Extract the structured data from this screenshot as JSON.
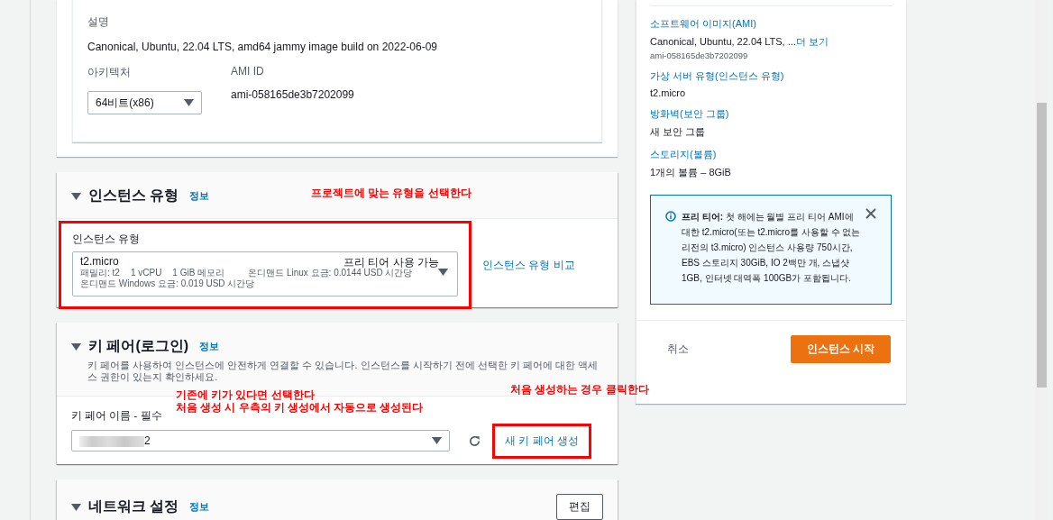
{
  "ami_details": {
    "description_label": "설명",
    "description": "Canonical, Ubuntu, 22.04 LTS, amd64 jammy image build on 2022-06-09",
    "architecture_label": "아키텍처",
    "architecture": "64비트(x86)",
    "ami_id_label": "AMI ID",
    "ami_id": "ami-058165de3b7202099"
  },
  "instance_type_section": {
    "title": "인스턴스 유형",
    "info_link": "정보",
    "highlighted": true,
    "field_label": "인스턴스 유형",
    "name": "t2.micro",
    "badge": "프리 티어 사용 가능",
    "family": "패밀리: t2",
    "vcpu": "1 vCPU",
    "memory": "1 GiB 메모리",
    "linux_price": "온디맨드 Linux 요금: 0.0144 USD 시간당",
    "windows_price": "온디맨드 Windows 요금: 0.019 USD 시간당",
    "compare_link": "인스턴스 유형 비교"
  },
  "key_pair_section": {
    "title": "키 페어(로그인)",
    "info_link": "정보",
    "description": "키 페어를 사용하여 인스턴스에 안전하게 연결할 수 있습니다. 인스턴스를 시작하기 전에 선택한 키 페어에 대한 액세스 권한이 있는지 확인하세요.",
    "field_label": "키 페어 이름 - 필수",
    "value": "2",
    "redacted": true,
    "create_link": "새 키 페어 생성",
    "create_highlighted": true
  },
  "network_section": {
    "title": "네트워크 설정",
    "info_link": "정보",
    "edit_button": "편집"
  },
  "summary": {
    "items": [
      {
        "label": "소프트웨어 이미지(AMI)",
        "value": "Canonical, Ubuntu, 22.04 LTS, ...",
        "more_link": "더 보기",
        "sub": "ami-058165de3b7202099"
      },
      {
        "label": "가상 서버 유형(인스턴스 유형)",
        "value": "t2.micro"
      },
      {
        "label": "방화벽(보안 그룹)",
        "value": "새 보안 그룹"
      },
      {
        "label": "스토리지(볼륨)",
        "value": "1개의 볼륨 – 8GiB"
      }
    ],
    "notice": "**프리 티어:** 첫 해에는 월별 프리 티어 AMI에 대한 t2.micro(또는 t2.micro를 사용할 수 없는 리전의 t3.micro) 인스턴스 사용량 750시간, EBS 스토리지 30GiB, IO 2백만 개, 스냅샷 1GB, 인터넷 대역폭 100GB가 포함됩니다.",
    "cancel_button": "취소",
    "launch_button": "인스턴스 시작"
  },
  "annotations": [
    {
      "text": "프로젝트에 맞는 유형을 선택한다"
    },
    {
      "text": "기존에 키가 있다면 선택한다"
    },
    {
      "text": "처음 생성 시 우측의 키 생성에서 자동으로 생성된다"
    },
    {
      "text": "처음 생성하는 경우 클릭한다"
    }
  ]
}
